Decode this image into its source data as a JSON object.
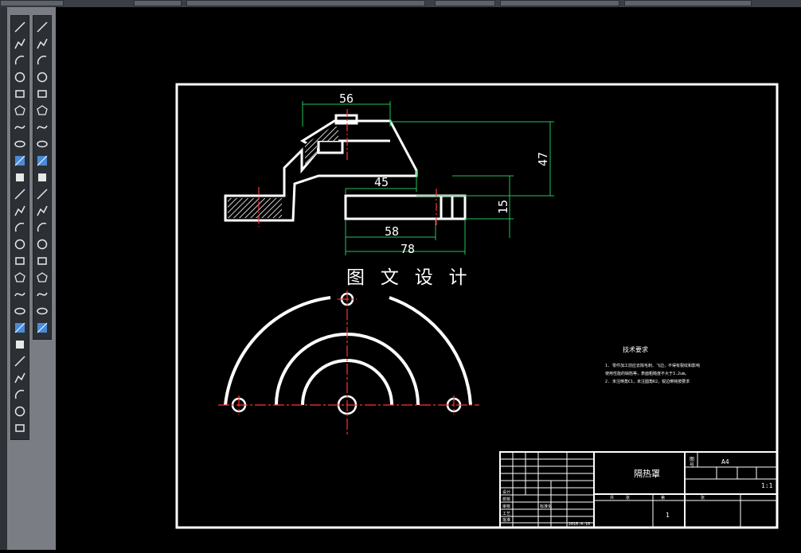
{
  "toolbars": {
    "draw_tools": [
      "line-icon",
      "polyline-icon",
      "arc-icon",
      "circle-icon",
      "rectangle-icon",
      "polygon-icon",
      "spline-icon",
      "ellipse-icon",
      "hatch-icon",
      "region-icon",
      "table-icon",
      "text-icon",
      "block-icon",
      "point-icon",
      "gradient-icon",
      "revcloud-icon",
      "wipeout-icon",
      "xline-icon",
      "ray-icon",
      "mtext-icon",
      "insert-icon",
      "construction-icon",
      "divide-icon",
      "measure-icon",
      "boundary-icon"
    ],
    "modify_tools": [
      "erase-icon",
      "copy-icon",
      "mirror-icon",
      "offset-icon",
      "array-icon",
      "move-icon",
      "rotate-icon",
      "scale-icon",
      "stretch-icon",
      "trim-icon",
      "extend-icon",
      "break-icon",
      "join-icon",
      "chamfer-icon",
      "fillet-icon",
      "explode-icon",
      "edit-icon",
      "blend-icon",
      "3d-icon"
    ]
  },
  "drawing": {
    "watermark": "图 文 设 计",
    "dimensions": {
      "top_width": "56",
      "height_47": "47",
      "inner_45": "45",
      "thickness_15": "15",
      "base_58": "58",
      "overall_78": "78"
    },
    "tech_requirements": {
      "title": "技术要求",
      "lines": [
        "1. 零件加工前应去除毛刺、飞边，不得有裂纹和影响",
        "使用性能的缺陷等，表面粗糙度不大于3.2um。",
        "2. 未注倒角C1，未注圆角R2，锐边倒钝按要求"
      ]
    },
    "title_block": {
      "part_name": "隔热罩",
      "sheet_label": "A4",
      "scale": "1:1",
      "quantity": "1",
      "header_cells": [
        "共",
        "张",
        "第",
        "张",
        "图",
        "号"
      ],
      "labels": [
        "设计",
        "校核",
        "审核",
        "工艺",
        "批准",
        "标准化"
      ],
      "date": "2016.4.10"
    }
  },
  "colors": {
    "background": "#000000",
    "line": "#ffffff",
    "centerline": "#ff3333",
    "dimension": "#22c55e",
    "toolbar_bg": "#7a7e84"
  }
}
